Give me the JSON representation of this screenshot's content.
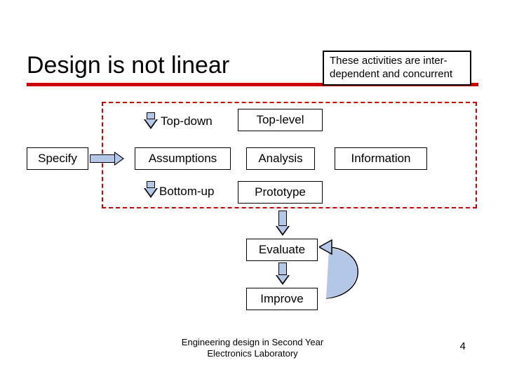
{
  "title": "Design is not linear",
  "callout": "These activities are inter-dependent and concurrent",
  "labels": {
    "topdown": "Top-down",
    "bottomup": "Bottom-up"
  },
  "boxes": {
    "specify": "Specify",
    "assumptions": "Assumptions",
    "toplevel": "Top-level",
    "analysis": "Analysis",
    "prototype": "Prototype",
    "information": "Information",
    "evaluate": "Evaluate",
    "improve": "Improve"
  },
  "footer_line1": "Engineering design in Second Year",
  "footer_line2": "Electronics Laboratory",
  "page_number": "4"
}
